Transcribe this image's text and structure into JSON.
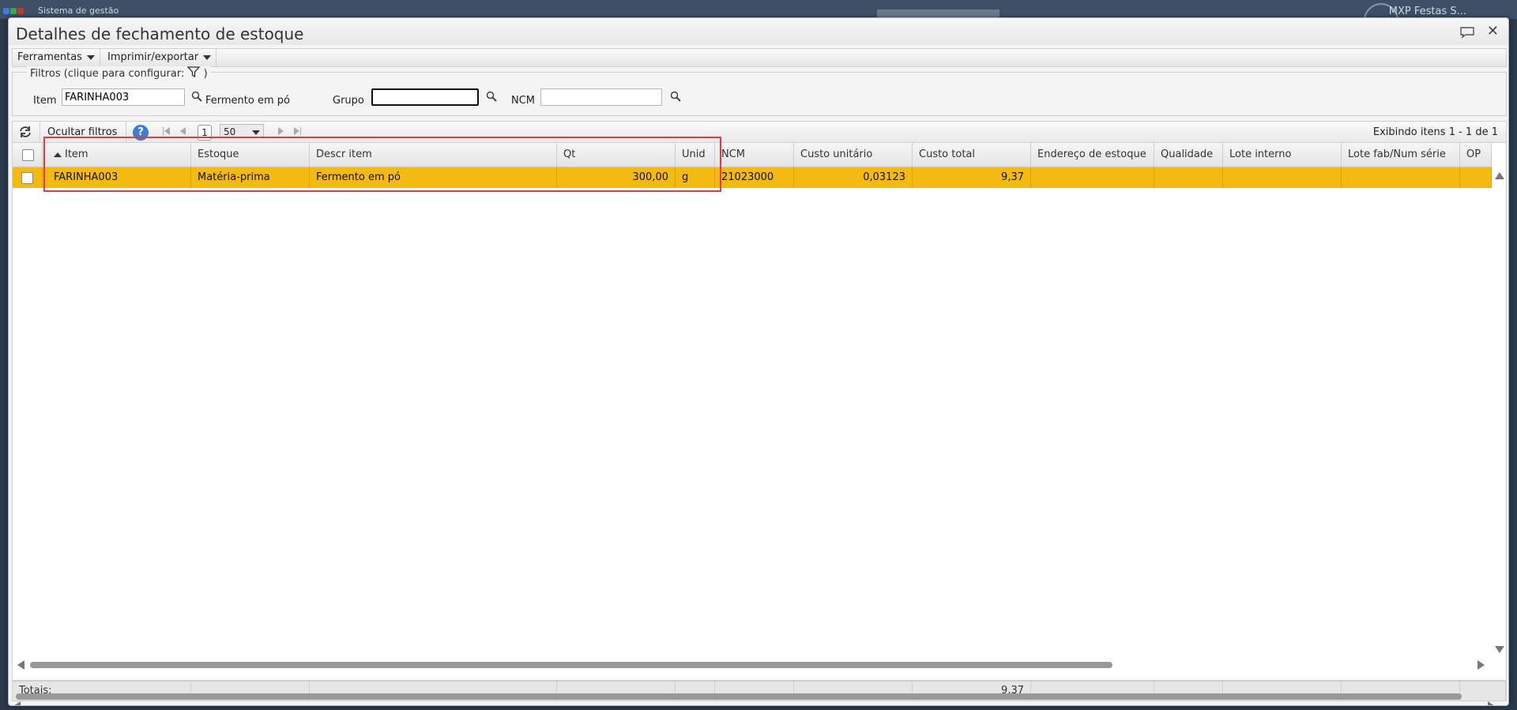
{
  "app": {
    "title": "Sistema de gestão",
    "company": "MXP Festas S..."
  },
  "modal": {
    "title": "Detalhes de fechamento de estoque"
  },
  "menu": {
    "tools": "Ferramentas",
    "print_export": "Imprimir/exportar"
  },
  "filters": {
    "legend": "Filtros (clique para configurar:",
    "legend_end": ")",
    "item_label": "Item",
    "item_value": "FARINHA003",
    "item_desc": "Fermento em pó",
    "group_label": "Grupo",
    "group_value": "",
    "ncm_label": "NCM",
    "ncm_value": ""
  },
  "grid_toolbar": {
    "hide_filters": "Ocultar filtros",
    "help": "?",
    "page": "1",
    "page_size": "50",
    "info": "Exibindo itens 1 - 1 de 1"
  },
  "columns": [
    "Item",
    "Estoque",
    "Descr item",
    "Qt",
    "Unid",
    "NCM",
    "Custo unitário",
    "Custo total",
    "Endereço de estoque",
    "Qualidade",
    "Lote interno",
    "Lote fab/Num série",
    "OP"
  ],
  "rows": [
    {
      "item": "FARINHA003",
      "estoque": "Matéria-prima",
      "descr": "Fermento em pó",
      "qt": "300,00",
      "unid": "g",
      "ncm": "21023000",
      "custo_unit": "0,03123",
      "custo_total": "9,37",
      "endereco": "",
      "qualidade": "",
      "lote_interno": "",
      "lote_fab": "",
      "op": ""
    }
  ],
  "totals": {
    "label": "Totais:",
    "custo_total": "9,37"
  },
  "colors": {
    "selected_row": "#f5b914",
    "highlight_box": "#e8383d",
    "help_icon": "#3b7dd8"
  }
}
